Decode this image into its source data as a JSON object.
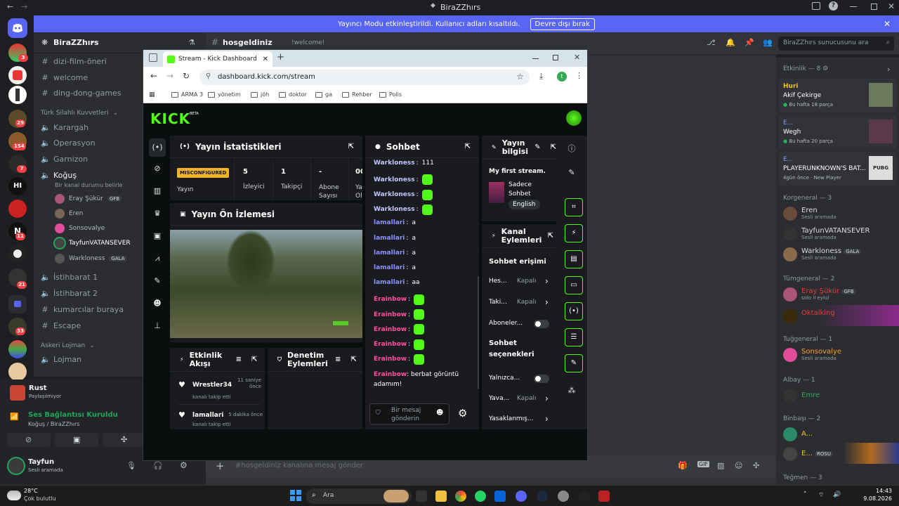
{
  "discord": {
    "title": "BiraZZhırs",
    "banner": {
      "text": "Yayıncı Modu etkinleştirildi. Kullanıcı adları kısaltıldı.",
      "button": "Devre dışı bırak"
    },
    "server_name": "BiraZZhırs",
    "channel_header": {
      "name": "hosgeldiniz",
      "topic": "!welcome!"
    },
    "search_placeholder": "BiraZZhırs sunucusunu ara",
    "server_badges": [
      "3",
      "29",
      "154",
      "7",
      "11",
      "21",
      "33"
    ],
    "text_channels": [
      "dizi-film-öneri",
      "welcome",
      "ding-dong-games"
    ],
    "category_tsk": "Türk Silahlı Kuvvetleri",
    "voice_channels": [
      "Karargah",
      "Operasyon",
      "Garnizon",
      "Koğuş"
    ],
    "kogus_status": "Bir kanal durumu belirle",
    "kogus_users": [
      {
        "name": "Eray Şükür",
        "tag": "GFB"
      },
      {
        "name": "Eren",
        "tag": ""
      },
      {
        "name": "Sonsovalye",
        "tag": ""
      },
      {
        "name": "TayfunVATANSEVER",
        "tag": ""
      },
      {
        "name": "Warkloness",
        "tag": "GALA"
      }
    ],
    "more_channels": [
      "İstihbarat 1",
      "İstihbarat 2",
      "kumarcılar buraya",
      "Escape"
    ],
    "category_lojman": "Askeri Lojman",
    "lojman_channel": "Lojman",
    "activity": {
      "name": "Rust",
      "sub": "Paylaşılmıyor"
    },
    "voice_status": {
      "title": "Ses Bağlantısı Kuruldu",
      "sub": "Koğuş / BiraZZhırs"
    },
    "user": {
      "name": "Tayfun",
      "status": "Sesli aramada"
    },
    "message_placeholder": "#hosgeldiniz kanalına mesaj gönder",
    "members": {
      "events_header": "Etkinlik — 8",
      "events": [
        {
          "user": "Huri",
          "name": "Akif Çekirge",
          "sub": "Bu hafta 18 parça"
        },
        {
          "user": "E...",
          "name": "Wegh",
          "sub": "Bu hafta 20 parça"
        },
        {
          "user": "E...",
          "name": "PLAYERUNKNOWN'S BAT...",
          "sub": "4gün önce",
          "sub2": "New Player"
        }
      ],
      "korgeneral_header": "Korgeneral — 3",
      "korgeneral": [
        {
          "name": "Eren",
          "sub": "Sesli aramada",
          "tag": ""
        },
        {
          "name": "TayfunVATANSEVER",
          "sub": "Sesli aramada",
          "tag": ""
        },
        {
          "name": "Warkloness",
          "sub": "Sesli aramada",
          "tag": "GALA"
        }
      ],
      "tumgeneral_header": "Tümgeneral — 2",
      "tumgeneral": [
        {
          "name": "Eray Şükür",
          "sub": "solo il eylul",
          "tag": "GFB"
        },
        {
          "name": "Oktalking",
          "sub": "",
          "tag": ""
        }
      ],
      "tuggeneral_header": "Tuğgeneral — 1",
      "tuggeneral": [
        {
          "name": "Sonsovalye",
          "sub": "Sesli aramada"
        }
      ],
      "albay_header": "Albay — 1",
      "albay": [
        {
          "name": "Emre"
        }
      ],
      "binbasi_header": "Binbaşı — 2",
      "binbasi": [
        {
          "name": "A..."
        },
        {
          "name": "E...",
          "tag": "ROSU"
        }
      ],
      "tegmen_header": "Teğmen — 3"
    }
  },
  "chrome": {
    "tab_title": "Stream - Kick Dashboard",
    "url": "dashboard.kick.com/stream",
    "profile_letter": "t",
    "bookmarks": [
      "ARMA 3",
      "yönetim",
      "jöh",
      "doktor",
      "ga",
      "Rehber",
      "Polis"
    ]
  },
  "kick": {
    "logo": "KICK",
    "logo_sup": "BETA",
    "stats": {
      "title": "Yayın İstatistikleri",
      "badge": "MISCONFIGURED",
      "items": [
        {
          "value": "",
          "label": "Yayın"
        },
        {
          "value": "5",
          "label": "İzleyici"
        },
        {
          "value": "1",
          "label": "Takipçi"
        },
        {
          "value": "-",
          "label": "Abone Sayısı"
        },
        {
          "value": "00",
          "label": "Ya Ol"
        }
      ]
    },
    "preview_title": "Yayın Ön İzlemesi",
    "activity": {
      "title": "Etkinlik Akışı",
      "items": [
        {
          "user": "Wrestler34",
          "time": "11 saniye önce",
          "action": "kanalı takip etti"
        },
        {
          "user": "lamallari",
          "time": "5 dakika önce",
          "action": "kanalı takip etti"
        }
      ]
    },
    "moderation_title": "Denetim Eylemleri",
    "chat": {
      "title": "Sohbet",
      "placeholder": "Bir mesaj gönderin",
      "messages": [
        {
          "user": "Warkloness",
          "text": "111",
          "emote": false
        },
        {
          "user": "Warkloness",
          "text": "",
          "emote": true
        },
        {
          "user": "Warkloness",
          "text": "",
          "emote": true
        },
        {
          "user": "Warkloness",
          "text": "",
          "emote": true
        },
        {
          "user": "lamallari",
          "text": "a",
          "emote": false
        },
        {
          "user": "lamallari",
          "text": "a",
          "emote": false
        },
        {
          "user": "lamallari",
          "text": "a",
          "emote": false
        },
        {
          "user": "lamallari",
          "text": "a",
          "emote": false
        },
        {
          "user": "lamallari",
          "text": "aa",
          "emote": false
        },
        {
          "user": "Erainbow",
          "text": "",
          "emote": true
        },
        {
          "user": "Erainbow",
          "text": "",
          "emote": true
        },
        {
          "user": "Erainbow",
          "text": "",
          "emote": true
        },
        {
          "user": "Erainbow",
          "text": "",
          "emote": true
        },
        {
          "user": "Erainbow",
          "text": "",
          "emote": true
        }
      ],
      "last_user": "Erainbow",
      "last_text_1": "berbat görüntü",
      "last_text_2": "adamım!"
    },
    "info": {
      "title_1": "Yayın",
      "title_2": "bilgisi",
      "stream_title": "My first stream.",
      "category_1": "Sadece",
      "category_2": "Sohbet",
      "language": "English"
    },
    "channel_actions": {
      "title_1": "Kanal",
      "title_2": "Eylemleri",
      "access_title": "Sohbet erişimi",
      "rows": [
        {
          "label": "Hes...",
          "value": "Kapalı"
        },
        {
          "label": "Taki...",
          "value": "Kapalı"
        },
        {
          "label": "Aboneler...",
          "value": ""
        }
      ],
      "options_title_1": "Sohbet",
      "options_title_2": "seçenekleri",
      "rows2": [
        {
          "label": "Yalnızca...",
          "value": ""
        },
        {
          "label": "Yava...",
          "value": "Kapalı"
        },
        {
          "label": "Yasaklanmış...",
          "value": ""
        }
      ]
    }
  },
  "taskbar": {
    "weather_temp": "28°C",
    "weather_desc": "Çok bulutlu",
    "search": "Ara",
    "time": "14:43",
    "date": "9.08.2026"
  },
  "colors": {
    "kick_green": "#53fc18",
    "discord_blurple": "#5865f2",
    "erainbow": "#ff4fa1",
    "warkloness": "#c3c6ff",
    "lamallari": "#8b93ff"
  }
}
